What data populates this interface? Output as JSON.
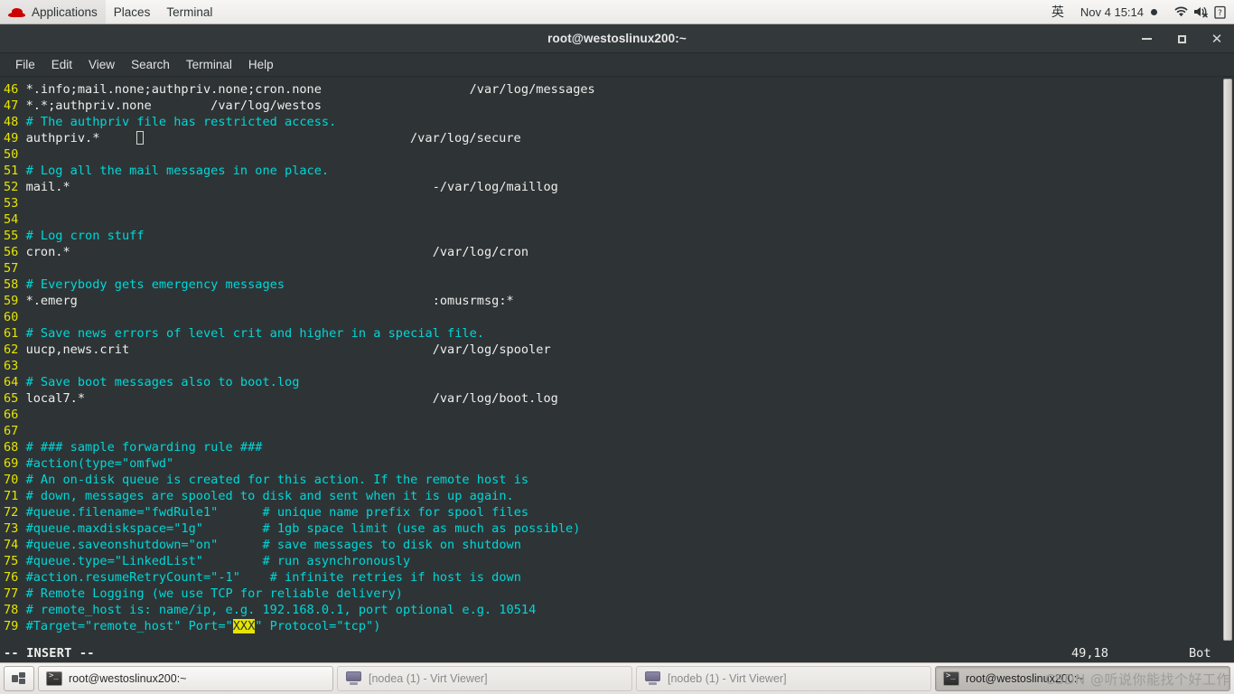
{
  "top_panel": {
    "logo_icon": "redhat-logo-icon",
    "menus": [
      {
        "label": "Applications"
      },
      {
        "label": "Places"
      },
      {
        "label": "Terminal"
      }
    ],
    "input_method": "英",
    "clock": "Nov 4  15:14",
    "tray": [
      {
        "icon": "wifi-icon"
      },
      {
        "icon": "volume-muted-icon"
      },
      {
        "icon": "battery-unknown-icon"
      }
    ]
  },
  "window": {
    "title": "root@westoslinux200:~",
    "buttons": {
      "minimize": "minimize-button",
      "maximize": "maximize-button",
      "close": "close-button"
    },
    "menubar": [
      {
        "label": "File"
      },
      {
        "label": "Edit"
      },
      {
        "label": "View"
      },
      {
        "label": "Search"
      },
      {
        "label": "Terminal"
      },
      {
        "label": "Help"
      }
    ]
  },
  "terminal": {
    "editor": "vim",
    "colors": {
      "background": "#2e3436",
      "foreground": "#d3d7cf",
      "line_number": "#e5e500",
      "comment": "#00d7d7",
      "search_highlight_bg": "#e5e500",
      "search_highlight_fg": "#2e3436"
    },
    "lines": [
      {
        "n": "46",
        "segments": [
          {
            "t": "*.info;mail.none;authpriv.none;cron.none                    /var/log/messages",
            "c": "txt"
          }
        ]
      },
      {
        "n": "47",
        "segments": [
          {
            "t": "*.*;authpriv.none        /var/log/westos",
            "c": "txt"
          }
        ]
      },
      {
        "n": "48",
        "segments": [
          {
            "t": "# The authpriv file has restricted access.",
            "c": "cmt"
          }
        ]
      },
      {
        "n": "49",
        "segments": [
          {
            "t": "authpriv.*     ",
            "c": "txt"
          },
          {
            "t": "CURSOR",
            "c": "cursor"
          },
          {
            "t": "                                    /var/log/secure",
            "c": "txt"
          }
        ]
      },
      {
        "n": "50",
        "segments": []
      },
      {
        "n": "51",
        "segments": [
          {
            "t": "# Log all the mail messages in one place.",
            "c": "cmt"
          }
        ]
      },
      {
        "n": "52",
        "segments": [
          {
            "t": "mail.*                                                 -/var/log/maillog",
            "c": "txt"
          }
        ]
      },
      {
        "n": "53",
        "segments": []
      },
      {
        "n": "54",
        "segments": []
      },
      {
        "n": "55",
        "segments": [
          {
            "t": "# Log cron stuff",
            "c": "cmt"
          }
        ]
      },
      {
        "n": "56",
        "segments": [
          {
            "t": "cron.*                                                 /var/log/cron",
            "c": "txt"
          }
        ]
      },
      {
        "n": "57",
        "segments": []
      },
      {
        "n": "58",
        "segments": [
          {
            "t": "# Everybody gets emergency messages",
            "c": "cmt"
          }
        ]
      },
      {
        "n": "59",
        "segments": [
          {
            "t": "*.emerg                                                :omusrmsg:*",
            "c": "txt"
          }
        ]
      },
      {
        "n": "60",
        "segments": []
      },
      {
        "n": "61",
        "segments": [
          {
            "t": "# Save news errors of level crit and higher in a special file.",
            "c": "cmt"
          }
        ]
      },
      {
        "n": "62",
        "segments": [
          {
            "t": "uucp,news.crit                                         /var/log/spooler",
            "c": "txt"
          }
        ]
      },
      {
        "n": "63",
        "segments": []
      },
      {
        "n": "64",
        "segments": [
          {
            "t": "# Save boot messages also to boot.log",
            "c": "cmt"
          }
        ]
      },
      {
        "n": "65",
        "segments": [
          {
            "t": "local7.*                                               /var/log/boot.log",
            "c": "txt"
          }
        ]
      },
      {
        "n": "66",
        "segments": []
      },
      {
        "n": "67",
        "segments": []
      },
      {
        "n": "68",
        "segments": [
          {
            "t": "# ### sample forwarding rule ###",
            "c": "cmt"
          }
        ]
      },
      {
        "n": "69",
        "segments": [
          {
            "t": "#action(type=\"omfwd\"",
            "c": "cmt"
          }
        ]
      },
      {
        "n": "70",
        "segments": [
          {
            "t": "# An on-disk queue is created for this action. If the remote host is",
            "c": "cmt"
          }
        ]
      },
      {
        "n": "71",
        "segments": [
          {
            "t": "# down, messages are spooled to disk and sent when it is up again.",
            "c": "cmt"
          }
        ]
      },
      {
        "n": "72",
        "segments": [
          {
            "t": "#queue.filename=\"fwdRule1\"      # unique name prefix for spool files",
            "c": "cmt"
          }
        ]
      },
      {
        "n": "73",
        "segments": [
          {
            "t": "#queue.maxdiskspace=\"1g\"        # 1gb space limit (use as much as possible)",
            "c": "cmt"
          }
        ]
      },
      {
        "n": "74",
        "segments": [
          {
            "t": "#queue.saveonshutdown=\"on\"      # save messages to disk on shutdown",
            "c": "cmt"
          }
        ]
      },
      {
        "n": "75",
        "segments": [
          {
            "t": "#queue.type=\"LinkedList\"        # run asynchronously",
            "c": "cmt"
          }
        ]
      },
      {
        "n": "76",
        "segments": [
          {
            "t": "#action.resumeRetryCount=\"-1\"    # infinite retries if host is down",
            "c": "cmt"
          }
        ]
      },
      {
        "n": "77",
        "segments": [
          {
            "t": "# Remote Logging (we use TCP for reliable delivery)",
            "c": "cmt"
          }
        ]
      },
      {
        "n": "78",
        "segments": [
          {
            "t": "# remote_host is: name/ip, e.g. 192.168.0.1, port optional e.g. 10514",
            "c": "cmt"
          }
        ]
      },
      {
        "n": "79",
        "segments": [
          {
            "t": "#Target=\"remote_host\" Port=\"",
            "c": "cmt"
          },
          {
            "t": "XXX",
            "c": "hl"
          },
          {
            "t": "\" Protocol=\"tcp\")",
            "c": "cmt"
          }
        ]
      }
    ],
    "status": {
      "mode": "-- INSERT --",
      "position": "49,18",
      "scroll": "Bot"
    }
  },
  "taskbar": {
    "workspace_switcher_icon": "workspace-switcher-icon",
    "tasks": [
      {
        "label": "root@westoslinux200:~",
        "icon": "terminal-icon",
        "state": "normal"
      },
      {
        "label": "[nodea (1) - Virt Viewer]",
        "icon": "virt-viewer-icon",
        "state": "inactive"
      },
      {
        "label": "[nodeb (1) - Virt Viewer]",
        "icon": "virt-viewer-icon",
        "state": "inactive"
      },
      {
        "label": "root@westoslinux200:~",
        "icon": "terminal-icon",
        "state": "active"
      }
    ]
  },
  "watermark": {
    "text": "CSDN @听说你能找个好工作"
  }
}
